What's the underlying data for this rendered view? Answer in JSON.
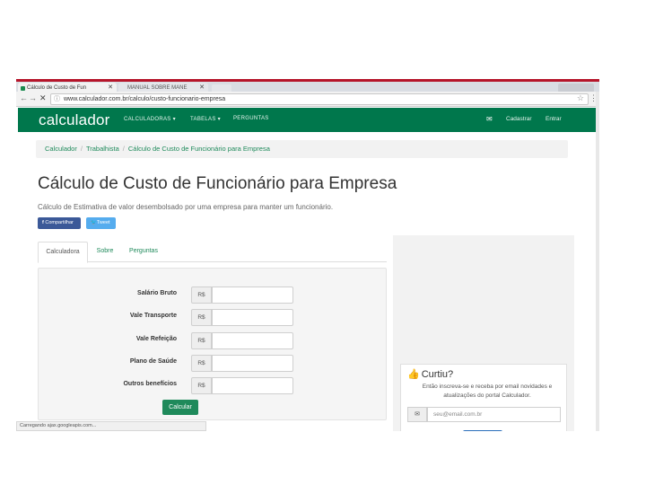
{
  "browser": {
    "tabs": [
      {
        "label": "Cálculo de Custo de Fun",
        "active": true
      },
      {
        "label": "MANUAL SOBRE MANE",
        "active": false
      }
    ],
    "url": "www.calculador.com.br/calculo/custo-funcionario-empresa",
    "status": "Carregando ajax.googleapis.com..."
  },
  "site": {
    "logo": "calculador",
    "nav": [
      "CALCULADORAS ▾",
      "TABELAS ▾",
      "PERGUNTAS"
    ],
    "account": [
      "Cadastrar",
      "Entrar"
    ],
    "brand_color": "#00774c"
  },
  "breadcrumb": [
    "Calculador",
    "Trabalhista",
    "Cálculo de Custo de Funcionário para Empresa"
  ],
  "page": {
    "title": "Cálculo de Custo de Funcionário para Empresa",
    "subtitle": "Cálculo de Estimativa de valor desembolsado por uma empresa para manter um funcionário.",
    "share": [
      "Compartilhar",
      "Tweet"
    ]
  },
  "tabs": [
    "Calculadora",
    "Sobre",
    "Perguntas"
  ],
  "form": {
    "currency": "R$",
    "fields": [
      {
        "label": "Salário Bruto",
        "value": ""
      },
      {
        "label": "Vale Transporte",
        "value": ""
      },
      {
        "label": "Vale Refeição",
        "value": ""
      },
      {
        "label": "Plano de Saúde",
        "value": ""
      },
      {
        "label": "Outros benefícios",
        "value": ""
      }
    ],
    "submit": "Calcular"
  },
  "sidebar": {
    "like_title": "Curtiu?",
    "like_text": "Então inscreva-se e receba por email novidades e atualizações do portal Calculador.",
    "email_placeholder": "seu@email.com.br"
  }
}
